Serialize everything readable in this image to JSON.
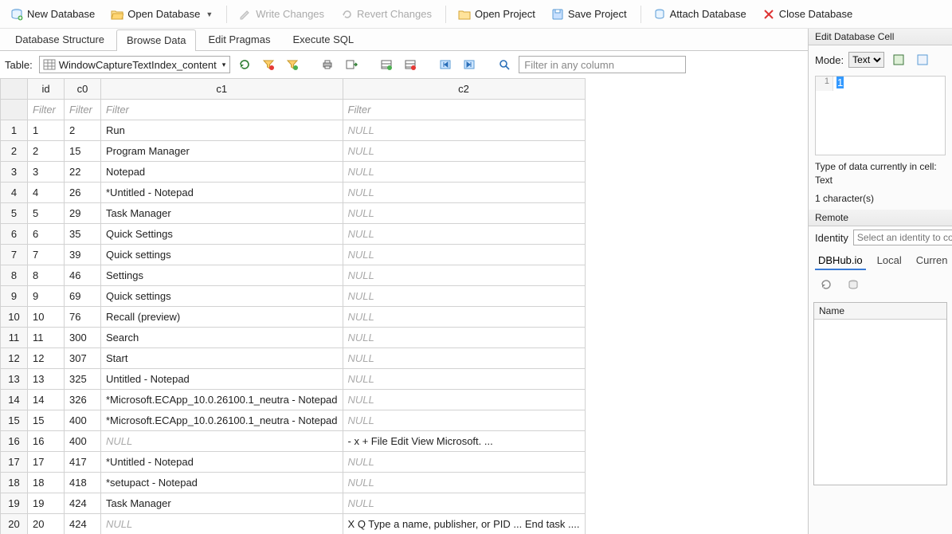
{
  "toolbar": {
    "new_db": "New Database",
    "open_db": "Open Database",
    "write_changes": "Write Changes",
    "revert_changes": "Revert Changes",
    "open_project": "Open Project",
    "save_project": "Save Project",
    "attach_db": "Attach Database",
    "close_db": "Close Database"
  },
  "main_tabs": {
    "structure": "Database Structure",
    "browse": "Browse Data",
    "pragmas": "Edit Pragmas",
    "sql": "Execute SQL"
  },
  "browse": {
    "table_label": "Table:",
    "table_name": "WindowCaptureTextIndex_content",
    "filter_placeholder": "Filter in any column",
    "col_filter_placeholder": "Filter",
    "columns": {
      "id": "id",
      "c0": "c0",
      "c1": "c1",
      "c2": "c2"
    },
    "rows": [
      {
        "n": "1",
        "id": "1",
        "c0": "2",
        "c1": "Run",
        "c2": null
      },
      {
        "n": "2",
        "id": "2",
        "c0": "15",
        "c1": "Program Manager",
        "c2": null
      },
      {
        "n": "3",
        "id": "3",
        "c0": "22",
        "c1": "Notepad",
        "c2": null
      },
      {
        "n": "4",
        "id": "4",
        "c0": "26",
        "c1": "*Untitled - Notepad",
        "c2": null
      },
      {
        "n": "5",
        "id": "5",
        "c0": "29",
        "c1": "Task Manager",
        "c2": null
      },
      {
        "n": "6",
        "id": "6",
        "c0": "35",
        "c1": "Quick Settings",
        "c2": null
      },
      {
        "n": "7",
        "id": "7",
        "c0": "39",
        "c1": "Quick settings",
        "c2": null
      },
      {
        "n": "8",
        "id": "8",
        "c0": "46",
        "c1": "Settings",
        "c2": null
      },
      {
        "n": "9",
        "id": "9",
        "c0": "69",
        "c1": "Quick settings",
        "c2": null
      },
      {
        "n": "10",
        "id": "10",
        "c0": "76",
        "c1": "Recall (preview)",
        "c2": null
      },
      {
        "n": "11",
        "id": "11",
        "c0": "300",
        "c1": "Search",
        "c2": null
      },
      {
        "n": "12",
        "id": "12",
        "c0": "307",
        "c1": "Start",
        "c2": null
      },
      {
        "n": "13",
        "id": "13",
        "c0": "325",
        "c1": "Untitled - Notepad",
        "c2": null
      },
      {
        "n": "14",
        "id": "14",
        "c0": "326",
        "c1": "*Microsoft.ECApp_10.0.26100.1_neutra - Notepad",
        "c2": null
      },
      {
        "n": "15",
        "id": "15",
        "c0": "400",
        "c1": "*Microsoft.ECApp_10.0.26100.1_neutra - Notepad",
        "c2": null
      },
      {
        "n": "16",
        "id": "16",
        "c0": "400",
        "c1": null,
        "c2": "- x + File Edit View Microsoft. ..."
      },
      {
        "n": "17",
        "id": "17",
        "c0": "417",
        "c1": "*Untitled - Notepad",
        "c2": null
      },
      {
        "n": "18",
        "id": "18",
        "c0": "418",
        "c1": "*setupact - Notepad",
        "c2": null
      },
      {
        "n": "19",
        "id": "19",
        "c0": "424",
        "c1": "Task Manager",
        "c2": null
      },
      {
        "n": "20",
        "id": "20",
        "c0": "424",
        "c1": null,
        "c2": "X Q Type a name, publisher, or PID ... End task ...."
      }
    ]
  },
  "edit_cell": {
    "title": "Edit Database Cell",
    "mode_label": "Mode:",
    "mode_value": "Text",
    "line_no": "1",
    "value": "1",
    "info_type": "Type of data currently in cell: Text",
    "info_chars": "1 character(s)"
  },
  "remote": {
    "title": "Remote",
    "identity_label": "Identity",
    "identity_placeholder": "Select an identity to con",
    "tabs": {
      "dbhub": "DBHub.io",
      "local": "Local",
      "current": "Curren"
    },
    "list_header": "Name"
  },
  "null_text": "NULL"
}
